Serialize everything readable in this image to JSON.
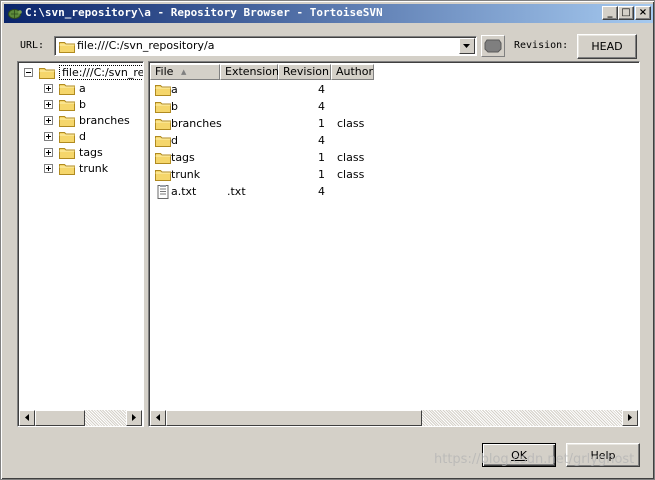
{
  "window": {
    "title": "C:\\svn_repository\\a - Repository Browser - TortoiseSVN",
    "controls": {
      "minimize": "_",
      "maximize": "□",
      "close": "×"
    }
  },
  "url_bar": {
    "label": "URL:",
    "value": "file:///C:/svn_repository/a"
  },
  "revision": {
    "label": "Revision:",
    "button_label": "HEAD"
  },
  "tree": {
    "root_label": "file:///C:/svn_rep",
    "items": [
      {
        "label": "a"
      },
      {
        "label": "b"
      },
      {
        "label": "branches"
      },
      {
        "label": "d"
      },
      {
        "label": "tags"
      },
      {
        "label": "trunk"
      }
    ]
  },
  "list": {
    "columns": [
      "File",
      "Extension",
      "Revision",
      "Author"
    ],
    "sort_indicator": "▲",
    "rows": [
      {
        "file": "a",
        "extension": "",
        "revision": "4",
        "author": "",
        "type": "folder"
      },
      {
        "file": "b",
        "extension": "",
        "revision": "4",
        "author": "",
        "type": "folder"
      },
      {
        "file": "branches",
        "extension": "",
        "revision": "1",
        "author": "class",
        "type": "folder"
      },
      {
        "file": "d",
        "extension": "",
        "revision": "4",
        "author": "",
        "type": "folder"
      },
      {
        "file": "tags",
        "extension": "",
        "revision": "1",
        "author": "class",
        "type": "folder"
      },
      {
        "file": "trunk",
        "extension": "",
        "revision": "1",
        "author": "class",
        "type": "folder"
      },
      {
        "file": "a.txt",
        "extension": ".txt",
        "revision": "4",
        "author": "",
        "type": "file"
      }
    ]
  },
  "buttons": {
    "ok": "OK",
    "help": "Help"
  },
  "watermark": "https://blog.csdn.net/grlyghost",
  "colors": {
    "titlebar_start": "#0a246a",
    "titlebar_end": "#a6caf0",
    "face": "#d4d0c8",
    "folder": "#f5d66b"
  },
  "icons": {
    "app": "tortoise-icon",
    "folder": "folder-icon",
    "file": "text-file-icon",
    "revision": "revision-graph-icon"
  }
}
